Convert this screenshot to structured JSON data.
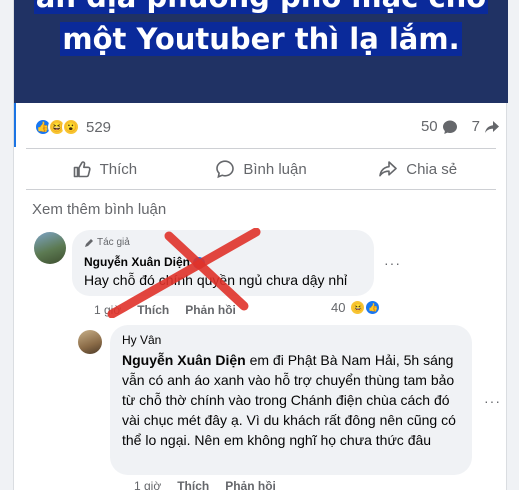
{
  "post": {
    "caption_line1": "ản địa phương phổ mặc cho",
    "caption_line2": "một Youtuber thì lạ lắm.",
    "reaction_count": "529",
    "comment_count": "50",
    "share_count": "7"
  },
  "actions": {
    "like": "Thích",
    "comment": "Bình luận",
    "share": "Chia sẻ"
  },
  "comments": {
    "view_more": "Xem thêm bình luận",
    "top": {
      "badge": "Tác giả",
      "author": "Nguyễn Xuân Diện",
      "text": "Hay chỗ đó chính quyền ngủ chưa dậy nhỉ",
      "time": "1 giờ",
      "like": "Thích",
      "reply": "Phản hồi",
      "reactions": "40"
    },
    "reply": {
      "author": "Hy Vân",
      "mention": "Nguyễn Xuân Diện",
      "text": " em đi Phật Bà Nam Hải, 5h sáng vẫn có anh áo xanh vào hỗ trợ chuyển thùng tam bảo từ chỗ thờ chính vào trong Chánh điện chùa cách đó vài chục mét đây ạ. Vì du khách rất đông nên cũng có thể lo ngại. Nên em không nghĩ họ chưa thức đâu",
      "time": "1 giờ",
      "like": "Thích",
      "reply": "Phản hồi"
    }
  },
  "colors": {
    "accent": "#1877f2",
    "annotation_cross": "#e0332b"
  }
}
